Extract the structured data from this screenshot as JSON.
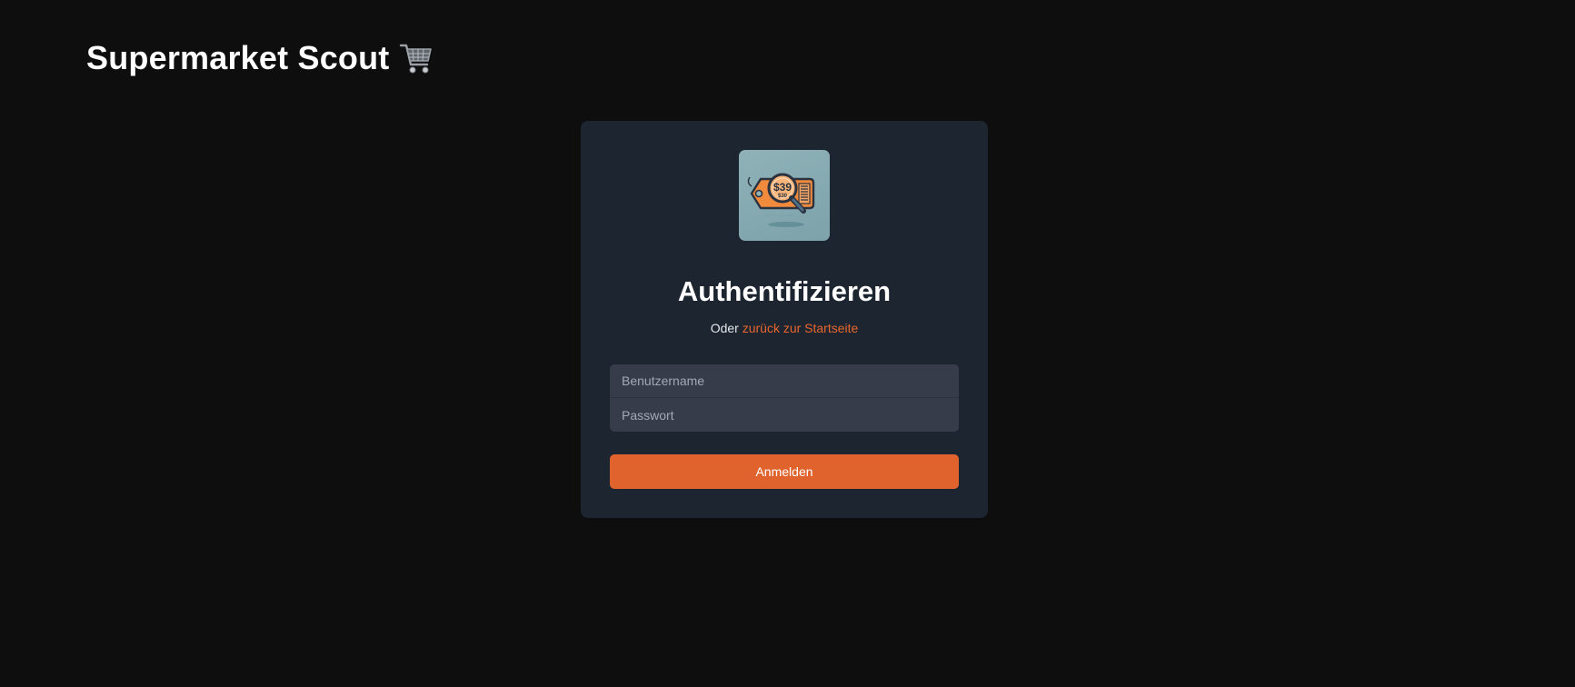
{
  "app": {
    "title": "Supermarket Scout",
    "title_icon": "shopping-cart-icon"
  },
  "auth": {
    "logo_icon": "price-tag-magnifier-icon",
    "logo_price_main": "$39",
    "logo_price_small": "$30",
    "heading": "Authentifizieren",
    "subtitle_prefix": "Oder",
    "home_link_label": "zurück zur Startseite",
    "username_placeholder": "Benutzername",
    "username_value": "",
    "password_placeholder": "Passwort",
    "password_value": "",
    "submit_label": "Anmelden"
  },
  "colors": {
    "background": "#0e0e0e",
    "card": "#1d2530",
    "input": "#363c4a",
    "accent": "#e0632e"
  }
}
